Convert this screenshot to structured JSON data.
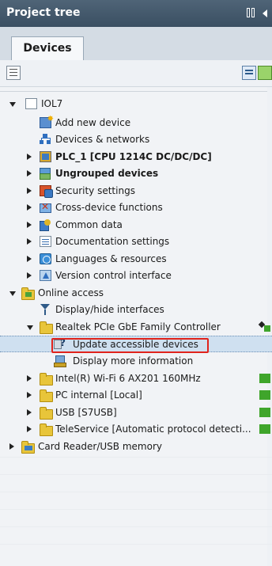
{
  "panel": {
    "title": "Project tree"
  },
  "tabs": [
    {
      "label": "Devices"
    }
  ],
  "tree": {
    "rows": [
      {
        "label": "IOL7"
      },
      {
        "label": "Add new device"
      },
      {
        "label": "Devices & networks"
      },
      {
        "label": "PLC_1 [CPU 1214C DC/DC/DC]"
      },
      {
        "label": "Ungrouped devices"
      },
      {
        "label": "Security settings"
      },
      {
        "label": "Cross-device functions"
      },
      {
        "label": "Common data"
      },
      {
        "label": "Documentation settings"
      },
      {
        "label": "Languages & resources"
      },
      {
        "label": "Version control interface"
      },
      {
        "label": "Online access"
      },
      {
        "label": "Display/hide interfaces"
      },
      {
        "label": "Realtek PCIe GbE Family Controller"
      },
      {
        "label": "Update accessible devices"
      },
      {
        "label": "Display more information"
      },
      {
        "label": "Intel(R) Wi-Fi 6 AX201 160MHz"
      },
      {
        "label": "PC internal [Local]"
      },
      {
        "label": "USB [S7USB]"
      },
      {
        "label": "TeleService [Automatic protocol detecti..."
      },
      {
        "label": "Card Reader/USB memory"
      }
    ]
  },
  "colors": {
    "header": "#3f5569",
    "selection": "#cfe0f0",
    "highlight_box": "#e0231c"
  }
}
